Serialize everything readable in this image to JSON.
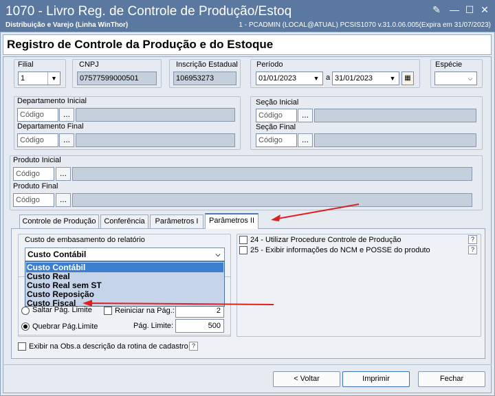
{
  "window": {
    "title": "1070 - Livro Reg. de Controle de Produção/Estoq",
    "subtitle_left": "Distribuição e Varejo (Linha WinThor)",
    "subtitle_right": "1 - PCADMIN (LOCAL@ATUAL)   PCSIS1070  v.31.0.06.005(Expira em 31/07/2023)",
    "btn_edit": "✎",
    "btn_min": "—",
    "btn_max": "☐",
    "btn_close": "✕"
  },
  "header": {
    "title": "Registro de Controle da Produção e do Estoque"
  },
  "filters": {
    "filial_label": "Filial",
    "filial_value": "1",
    "cnpj_label": "CNPJ",
    "cnpj_value": "07577599000501",
    "ie_label": "Inscrição Estadual",
    "ie_value": "106953273",
    "periodo_label": "Período",
    "periodo_inicio": "01/01/2023",
    "periodo_fim": "31/01/2023",
    "especie_label": "Espécie",
    "especie_value": ""
  },
  "departamento": {
    "inicial_label": "Departamento Inicial",
    "final_label": "Departamento Final",
    "codigo_placeholder": "Código",
    "button_label": "..."
  },
  "secao": {
    "inicial_label": "Seção Inicial",
    "final_label": "Seção Final",
    "codigo_placeholder": "Código",
    "button_label": "..."
  },
  "produto": {
    "inicial_label": "Produto Inicial",
    "final_label": "Produto Final",
    "codigo_placeholder": "Código",
    "button_label": "..."
  },
  "tabs": [
    {
      "label": "Controle de Produção"
    },
    {
      "label": "Conferência"
    },
    {
      "label": "Parâmetros I"
    },
    {
      "label": "Parâmetros II"
    }
  ],
  "params2": {
    "custo_group_label": "Custo de embasamento do relatório",
    "custo_selected": "Custo Contábil",
    "custo_options": [
      "Custo Contábil",
      "Custo Real",
      "Custo Real sem ST",
      "Custo Reposição",
      "Custo Fiscal"
    ],
    "saltar_label": "Saltar Pág. Limite",
    "quebrar_label": "Quebrar Pág.Limite",
    "reiniciar_label": "Reiniciar na Pág.:",
    "reiniciar_value": "2",
    "pag_limite_label": "Pág. Limite:",
    "pag_limite_value": "500",
    "opt24_label": "24 - Utilizar Procedure Controle de Produção",
    "opt25_label": "25 - Exibir informações do NCM e POSSE do produto",
    "obs_label": "Exibir na Obs.a descrição da rotina de cadastro",
    "help_glyph": "?"
  },
  "footer": {
    "voltar": "< Voltar",
    "imprimir": "Imprimir",
    "fechar": "Fechar"
  },
  "colors": {
    "titlebar": "#5a78a0",
    "arrow": "#e02020",
    "selection": "#3c7fd0"
  }
}
